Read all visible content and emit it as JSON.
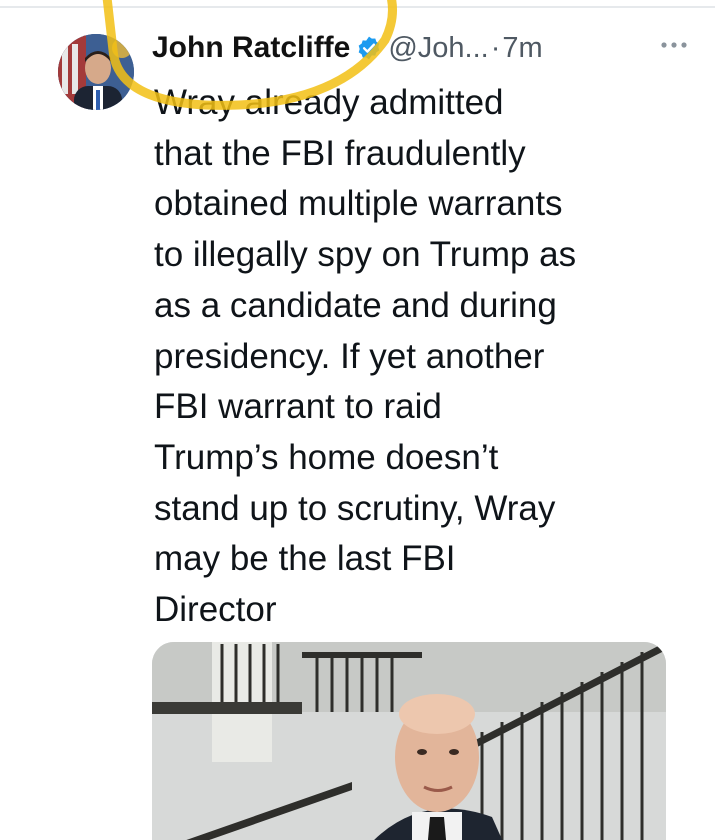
{
  "tweet": {
    "author": {
      "name": "John Ratcliffe",
      "handle": "@Joh...",
      "verified": true,
      "avatar_icon": "user-avatar"
    },
    "separator": "·",
    "time": "7m",
    "text": "Wray already admitted\nthat the FBI fraudulently\nobtained multiple warrants\nto illegally spy on Trump as\nas a candidate and during\npresidency. If yet another\nFBI warrant to raid\nTrump’s home doesn’t\nstand up to scrutiny, Wray\nmay be the last FBI\nDirector",
    "media": {
      "type": "photo",
      "icon": "tweet-photo"
    }
  },
  "colors": {
    "text": "#0f1419",
    "secondary": "#4f5963",
    "verified": "#1d9bf0",
    "highlight": "#f2c014"
  }
}
